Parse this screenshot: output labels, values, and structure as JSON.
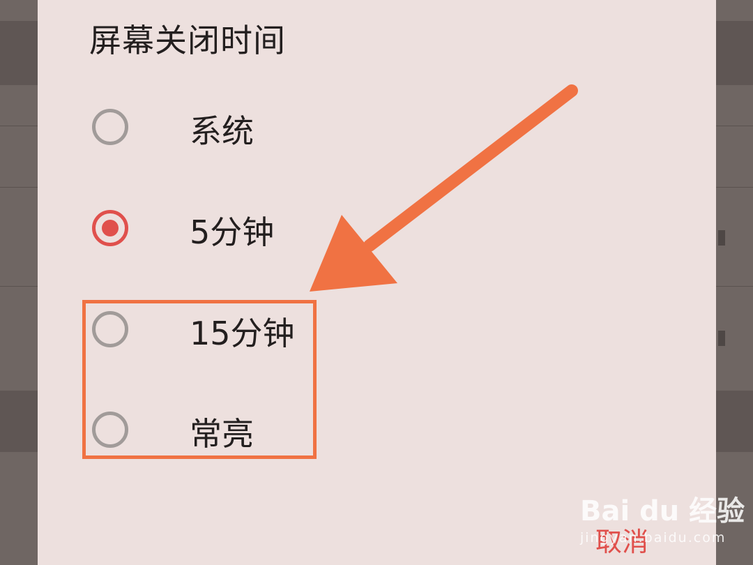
{
  "dialog": {
    "title": "屏幕关闭时间",
    "options": [
      {
        "label": "系统",
        "selected": false
      },
      {
        "label": "5分钟",
        "selected": true
      },
      {
        "label": "15分钟",
        "selected": false
      },
      {
        "label": "常亮",
        "selected": false
      }
    ],
    "cancel_label": "取消"
  },
  "watermark": {
    "main": "Bai du 经验",
    "sub": "jingyan.baidu.com"
  },
  "colors": {
    "accent": "#e0504c",
    "annotation": "#f07243",
    "dialog_bg": "#ede0de",
    "text": "#231f1f"
  }
}
